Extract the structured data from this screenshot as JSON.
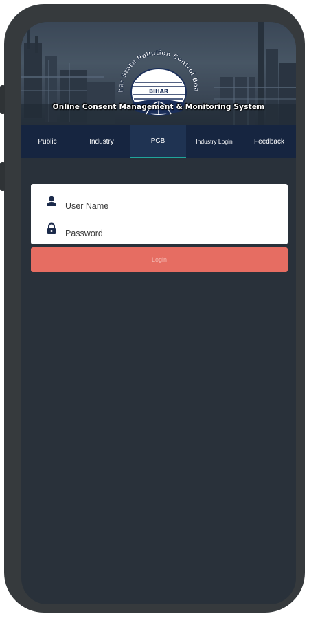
{
  "header": {
    "emblem_org_name": "Bihar State Pollution Control Board",
    "emblem_label": "BIHAR",
    "system_title": "Online Consent Management & Monitoring System"
  },
  "nav": {
    "tabs": [
      {
        "label": "Public",
        "active": false
      },
      {
        "label": "Industry",
        "active": false
      },
      {
        "label": "PCB",
        "active": true
      },
      {
        "label": "Industry Login",
        "active": false
      },
      {
        "label": "Feedback",
        "active": false
      }
    ]
  },
  "login": {
    "username_placeholder": "User Name",
    "password_placeholder": "Password",
    "username_icon": "person-icon",
    "password_icon": "lock-icon",
    "button_label": "Login"
  },
  "colors": {
    "nav_background": "#162540",
    "active_tab_indicator": "#21a59a",
    "login_button": "#e66d62",
    "screen_background": "#29313a"
  }
}
